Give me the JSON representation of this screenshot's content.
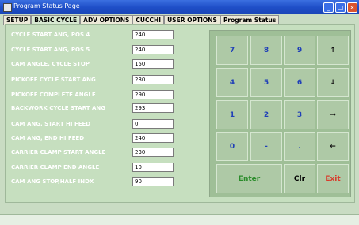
{
  "window": {
    "title": "Program Status Page",
    "minimize": "_",
    "maximize": "□",
    "close": "×"
  },
  "tabs": [
    "SETUP",
    "BASIC CYCLE",
    "ADV OPTIONS",
    "CUCCHI",
    "USER OPTIONS",
    "Program Status"
  ],
  "active_tab": "BASIC CYCLE",
  "fields": [
    {
      "label": "CYCLE START ANG, POS 4",
      "value": "240"
    },
    {
      "label": "CYCLE START ANG, POS 5",
      "value": "240"
    },
    {
      "label": "CAM ANGLE, CYCLE STOP",
      "value": "150"
    },
    {
      "label": "PICKOFF CYCLE START ANG",
      "value": "230"
    },
    {
      "label": "PICKOFF COMPLETE ANGLE",
      "value": "290"
    },
    {
      "label": "BACKWORK CYCLE START ANG",
      "value": "293"
    },
    {
      "label": "CAM ANG, START HI FEED",
      "value": "0"
    },
    {
      "label": "CAM ANG, END   HI FEED",
      "value": "240"
    },
    {
      "label": "CARRIER CLAMP START ANGLE",
      "value": "230"
    },
    {
      "label": "CARRIER CLAMP END ANGLE",
      "value": "10"
    },
    {
      "label": "CAM ANG STOP,HALF INDX",
      "value": "90"
    }
  ],
  "keypad": {
    "rows": [
      [
        "7",
        "8",
        "9",
        "↑"
      ],
      [
        "4",
        "5",
        "6",
        "↓"
      ],
      [
        "1",
        "2",
        "3",
        "→"
      ],
      [
        "0",
        "-",
        ".",
        "←"
      ]
    ],
    "enter": "Enter",
    "clear": "Clr",
    "exit": "Exit"
  },
  "colors": {
    "titlebar": "#1f4fc8",
    "panel": "#c6dfbf",
    "key": "#aec9a6",
    "enter": "#2a8c2a",
    "exit": "#d83b2b"
  }
}
